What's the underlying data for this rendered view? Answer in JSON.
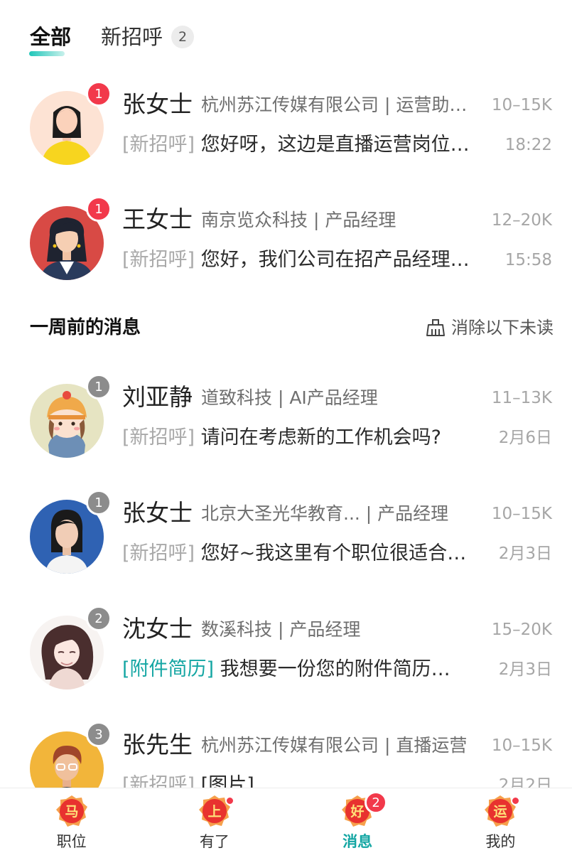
{
  "tabs": {
    "all": "全部",
    "greeting": "新招呼",
    "greeting_badge": "2"
  },
  "section": {
    "title": "一周前的消息",
    "clear_label": "消除以下未读"
  },
  "conversations": [
    {
      "name": "张女士",
      "company": "杭州苏江传媒有限公司 | 运营助…",
      "salary": "10–15K",
      "tag": "[新招呼]",
      "message": "您好呀，这边是直播运营岗位…",
      "time": "18:22",
      "unread": "1"
    },
    {
      "name": "王女士",
      "company": "南京览众科技 | 产品经理",
      "salary": "12–20K",
      "tag": "[新招呼]",
      "message": "您好，我们公司在招产品经理…",
      "time": "15:58",
      "unread": "1"
    },
    {
      "name": "刘亚静",
      "company": "道致科技 | AI产品经理",
      "salary": "11–13K",
      "tag": "[新招呼]",
      "message": "请问在考虑新的工作机会吗?",
      "time": "2月6日",
      "unread": "1"
    },
    {
      "name": "张女士",
      "company": "北京大圣光华教育... | 产品经理",
      "salary": "10–15K",
      "tag": "[新招呼]",
      "message": "您好~我这里有个职位很适合…",
      "time": "2月3日",
      "unread": "1"
    },
    {
      "name": "沈女士",
      "company": "数溪科技 | 产品经理",
      "salary": "15–20K",
      "tag": "[附件简历]",
      "message": "我想要一份您的附件简历…",
      "time": "2月3日",
      "unread": "2"
    },
    {
      "name": "张先生",
      "company": "杭州苏江传媒有限公司 | 直播运营",
      "salary": "10–15K",
      "tag": "[新招呼]",
      "message": "[图片]",
      "time": "2月2日",
      "unread": "3"
    }
  ],
  "bottom_nav": [
    {
      "icon_char": "马",
      "label": "职位"
    },
    {
      "icon_char": "上",
      "label": "有了"
    },
    {
      "icon_char": "好",
      "label": "消息",
      "badge": "2"
    },
    {
      "icon_char": "运",
      "label": "我的"
    }
  ],
  "colors": {
    "accent": "#14a6a3",
    "badge_red": "#f2394b",
    "badge_gray": "#8c8c8c"
  }
}
